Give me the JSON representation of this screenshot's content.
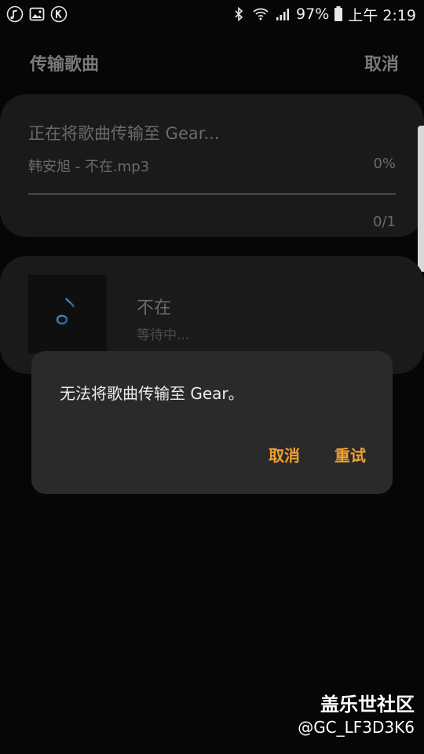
{
  "statusbar": {
    "icons_left": [
      "music-note-icon",
      "image-icon",
      "k-app-icon"
    ],
    "battery_percent": "97%",
    "time": "上午 2:19",
    "icons_right": [
      "bluetooth-icon",
      "wifi-icon",
      "signal-icon",
      "battery-icon"
    ]
  },
  "appbar": {
    "title": "传输歌曲",
    "cancel_label": "取消"
  },
  "transfer": {
    "title": "正在将歌曲传输至 Gear...",
    "filename": "韩安旭 - 不在.mp3",
    "percent": "0%",
    "progress_value": 0,
    "count": "0/1"
  },
  "song": {
    "title": "不在",
    "status": "等待中..."
  },
  "dialog": {
    "message": "无法将歌曲传输至 Gear。",
    "cancel_label": "取消",
    "retry_label": "重试"
  },
  "watermark": {
    "title": "盖乐世社区",
    "handle": "@GC_LF3D3K6"
  },
  "colors": {
    "accent": "#f0a030",
    "card_bg": "#1a1a1a",
    "dialog_bg": "#2a2a2a"
  }
}
